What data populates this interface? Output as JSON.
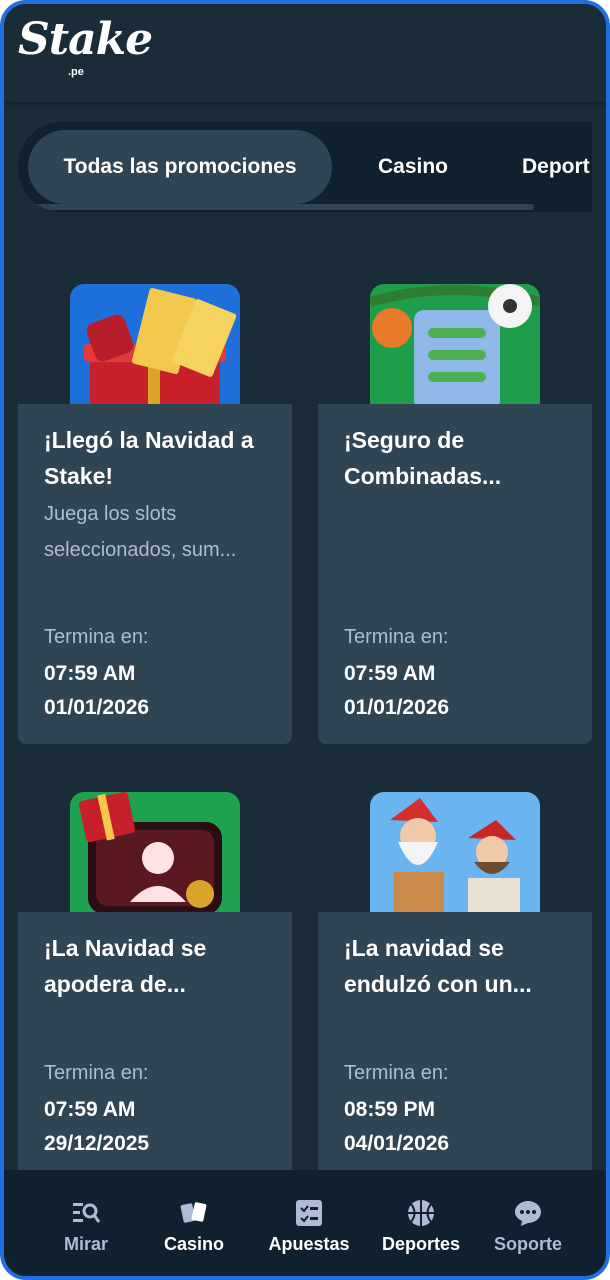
{
  "brand": {
    "name": "Stake",
    "domain": ".pe"
  },
  "tabs": [
    {
      "label": "Todas las promociones",
      "active": true
    },
    {
      "label": "Casino",
      "active": false
    },
    {
      "label": "Deport",
      "active": false
    }
  ],
  "promotions": [
    {
      "title": "¡Llegó la Navidad a Stake!",
      "description": "Juega los slots seleccionados, sum...",
      "ends_label": "Termina en:",
      "ends_time": "07:59 AM",
      "ends_date": "01/01/2026"
    },
    {
      "title": "¡Seguro de Combinadas...",
      "description": "",
      "ends_label": "Termina en:",
      "ends_time": "07:59 AM",
      "ends_date": "01/01/2026"
    },
    {
      "title": "¡La Navidad se apodera de...",
      "description": "",
      "ends_label": "Termina en:",
      "ends_time": "07:59 AM",
      "ends_date": "29/12/2025"
    },
    {
      "title": "¡La navidad se endulzó con un...",
      "description": "",
      "ends_label": "Termina en:",
      "ends_time": "08:59 PM",
      "ends_date": "04/01/2026"
    }
  ],
  "bottom_nav": [
    {
      "label": "Mirar",
      "icon": "browse-icon"
    },
    {
      "label": "Casino",
      "icon": "cards-icon"
    },
    {
      "label": "Apuestas",
      "icon": "betslip-icon"
    },
    {
      "label": "Deportes",
      "icon": "basketball-icon"
    },
    {
      "label": "Soporte",
      "icon": "chat-icon"
    }
  ],
  "colors": {
    "background": "#1a2c38",
    "card": "#2f4553",
    "nav": "#0f212e",
    "text_muted": "#b1bad3",
    "frame_border": "#1f6fe0"
  }
}
